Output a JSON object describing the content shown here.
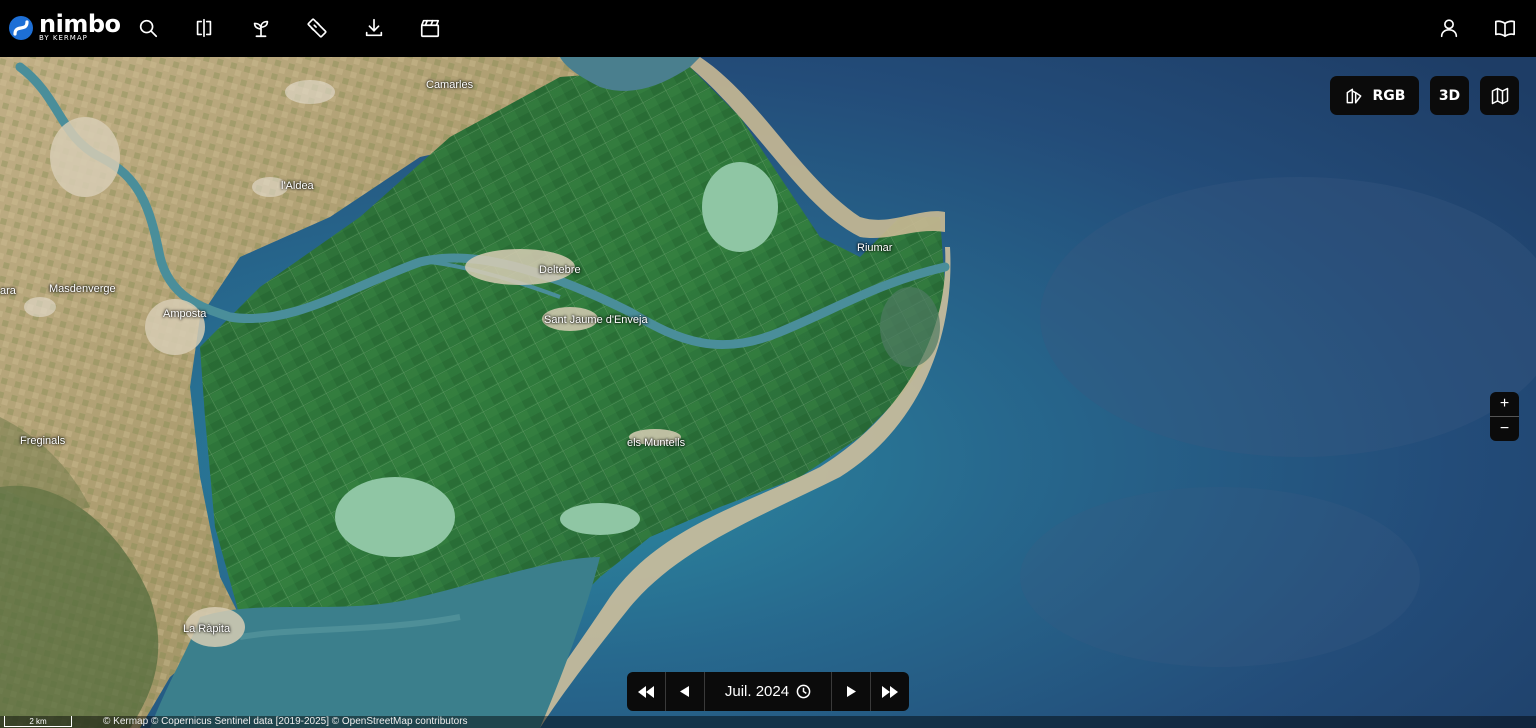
{
  "app": {
    "name": "nimbo",
    "byline": "BY KERMAP"
  },
  "toolbar": {
    "left_icons": [
      "search-icon",
      "compare-icon",
      "crop-icon",
      "measure-icon",
      "download-icon",
      "clapperboard-icon"
    ],
    "right_icons": [
      "user-icon",
      "book-icon"
    ]
  },
  "map_controls": {
    "layer_label": "RGB",
    "mode_3d_label": "3D",
    "zoom_in": "+",
    "zoom_out": "−"
  },
  "timeline": {
    "date_label": "Juil. 2024"
  },
  "places": {
    "camarles": "Camarles",
    "laldea": "l'Aldea",
    "riumar": "Riumar",
    "deltebre": "Deltebre",
    "masdenverge": "Masdenverge",
    "amposta": "Amposta",
    "sant_jaume": "Sant Jaume d'Enveja",
    "els_muntells": "els Muntells",
    "freginals": "Freginals",
    "la_rapita": "La Ràpita",
    "edge": "ara"
  },
  "scale_label": "2 km",
  "attribution": "© Kermap © Copernicus Sentinel data [2019-2025] © OpenStreetMap contributors",
  "colors": {
    "sea_dark": "#1f3f66",
    "sea_coast": "#2f8a9c",
    "delta_green": "#2f6e3a",
    "land_tan": "#b5a37a",
    "lagoon": "#8fc6a4"
  }
}
